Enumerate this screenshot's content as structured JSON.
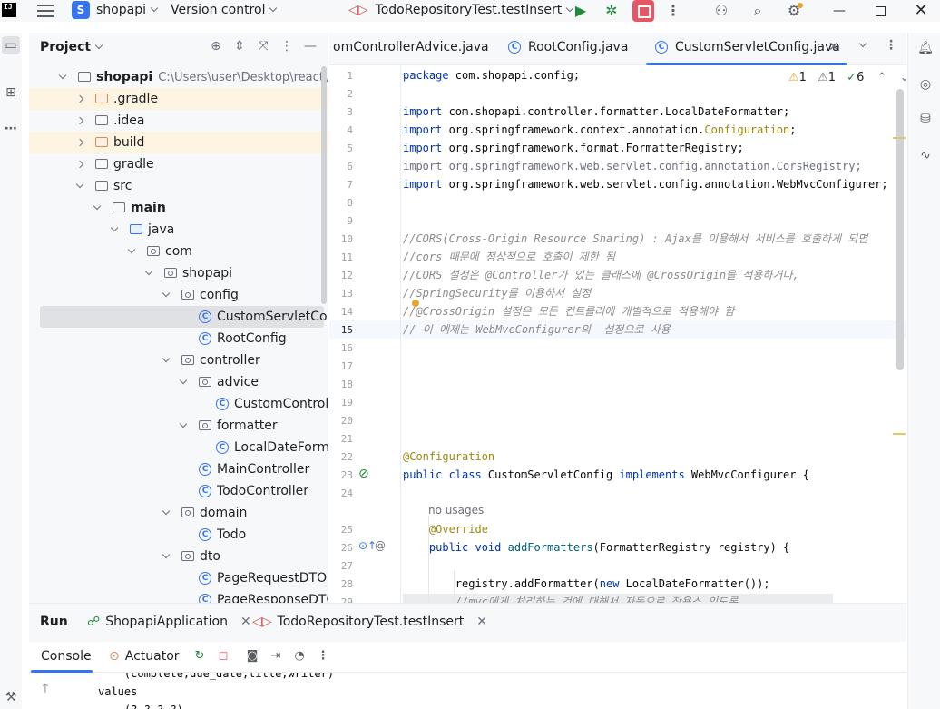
{
  "titlebar": {
    "logo_text": "IJ",
    "project_badge": "S",
    "project_name": "shopapi",
    "vcs_label": "Version control",
    "run_config": "TodoRepositoryTest.testInsert"
  },
  "project_panel": {
    "title": "Project",
    "tree": [
      {
        "label": "shopapi",
        "path": "C:\\Users\\user\\Desktop\\react\\backe",
        "bold": true,
        "level": 0,
        "arrow": "down",
        "icon": "module"
      },
      {
        "label": ".gradle",
        "level": 1,
        "arrow": "right",
        "icon": "folder-orange",
        "highlight": true
      },
      {
        "label": ".idea",
        "level": 1,
        "arrow": "right",
        "icon": "folder"
      },
      {
        "label": "build",
        "level": 1,
        "arrow": "right",
        "icon": "folder-orange",
        "highlight": true
      },
      {
        "label": "gradle",
        "level": 1,
        "arrow": "right",
        "icon": "folder"
      },
      {
        "label": "src",
        "level": 1,
        "arrow": "down",
        "icon": "folder"
      },
      {
        "label": "main",
        "level": 2,
        "arrow": "down",
        "icon": "folder",
        "bold": true
      },
      {
        "label": "java",
        "level": 3,
        "arrow": "down",
        "icon": "folder-blue"
      },
      {
        "label": "com",
        "level": 4,
        "arrow": "down",
        "icon": "package"
      },
      {
        "label": "shopapi",
        "level": 5,
        "arrow": "down",
        "icon": "package"
      },
      {
        "label": "config",
        "level": 6,
        "arrow": "down",
        "icon": "package"
      },
      {
        "label": "CustomServletConfig",
        "level": 7,
        "icon": "class",
        "selected": true
      },
      {
        "label": "RootConfig",
        "level": 7,
        "icon": "class"
      },
      {
        "label": "controller",
        "level": 6,
        "arrow": "down",
        "icon": "package"
      },
      {
        "label": "advice",
        "level": 7,
        "arrow": "down",
        "icon": "package"
      },
      {
        "label": "CustomControllerAd",
        "level": 8,
        "icon": "class"
      },
      {
        "label": "formatter",
        "level": 7,
        "arrow": "down",
        "icon": "package"
      },
      {
        "label": "LocalDateFormatter",
        "level": 8,
        "icon": "class"
      },
      {
        "label": "MainController",
        "level": 7,
        "icon": "class"
      },
      {
        "label": "TodoController",
        "level": 7,
        "icon": "class"
      },
      {
        "label": "domain",
        "level": 6,
        "arrow": "down",
        "icon": "package"
      },
      {
        "label": "Todo",
        "level": 7,
        "icon": "class"
      },
      {
        "label": "dto",
        "level": 6,
        "arrow": "down",
        "icon": "package"
      },
      {
        "label": "PageRequestDTO",
        "level": 7,
        "icon": "class"
      },
      {
        "label": "PageResponseDTO",
        "level": 7,
        "icon": "class"
      }
    ]
  },
  "tabs": [
    {
      "label": "omControllerAdvice.java",
      "active": false
    },
    {
      "label": "RootConfig.java",
      "active": false
    },
    {
      "label": "CustomServletConfig.java",
      "active": true
    }
  ],
  "editor": {
    "hints": {
      "warn_yellow": "1",
      "warn_grey": "1",
      "ok": "6"
    },
    "usages": "no usages",
    "lines": [
      {
        "n": "1",
        "html": "<span class='kw'>package</span> com.shopapi.config;"
      },
      {
        "n": "2",
        "html": ""
      },
      {
        "n": "3",
        "html": "<span class='kw'>import</span> com.shopapi.controller.formatter.LocalDateFormatter;"
      },
      {
        "n": "4",
        "html": "<span class='kw'>import</span> org.springframework.context.annotation.<span class='ann'>Configuration</span>;"
      },
      {
        "n": "5",
        "html": "<span class='kw'>import</span> org.springframework.format.FormatterRegistry;"
      },
      {
        "n": "6",
        "html": "<span class='grey'>import org.springframework.web.servlet.config.annotation.CorsRegistry;</span>"
      },
      {
        "n": "7",
        "html": "<span class='kw'>import</span> org.springframework.web.servlet.config.annotation.WebMvcConfigurer;"
      },
      {
        "n": "8",
        "html": ""
      },
      {
        "n": "9",
        "html": ""
      },
      {
        "n": "10",
        "html": "<span class='cmt'>//CORS(Cross-Origin Resource Sharing) : Ajax를 이용해서 서비스를 호출하게 되면</span>"
      },
      {
        "n": "11",
        "html": "<span class='cmt'>//cors 때문에 정상적으로 호출이 제한 됨</span>"
      },
      {
        "n": "12",
        "html": "<span class='cmt'>//CORS 설정은 @Controller가 있는 클래스에 @CrossOrigin을 적용하거나,</span>"
      },
      {
        "n": "13",
        "html": "<span class='cmt'>//SpringSecurity를 이용하서 설정</span>"
      },
      {
        "n": "14",
        "html": "<span class='cmt'>//@CrossOrigin 설정은 모든 컨트롤러에 개별적으로 적용해야 함</span>"
      },
      {
        "n": "15",
        "html": "<span class='cmt'>// 이 예제는 WebMvcConfigurer의  설정으로 사용</span>"
      },
      {
        "n": "16",
        "html": ""
      },
      {
        "n": "17",
        "html": ""
      },
      {
        "n": "18",
        "html": ""
      },
      {
        "n": "19",
        "html": ""
      },
      {
        "n": "20",
        "html": ""
      },
      {
        "n": "21",
        "html": ""
      },
      {
        "n": "22",
        "html": "<span class='ann'>@Configuration</span>"
      },
      {
        "n": "23",
        "html": "<span class='kw'>public class</span> CustomServletConfig <span class='kw'>implements</span> WebMvcConfigurer {"
      },
      {
        "n": "24",
        "html": ""
      },
      {
        "n": "25",
        "html": "    <span class='ann'>@Override</span>"
      },
      {
        "n": "26",
        "html": "    <span class='kw'>public void</span> <span class='fn'>addFormatters</span>(FormatterRegistry registry) {"
      },
      {
        "n": "27",
        "html": ""
      },
      {
        "n": "28",
        "html": "        registry.addFormatter(<span class='kw'>new</span> LocalDateFormatter());"
      },
      {
        "n": "29",
        "html": "        <span class='cmt'>//mvc에게 처리하는 것에 대해서 자동으로 작용스 있도록</span>"
      }
    ]
  },
  "run_panel": {
    "title": "Run",
    "tabs": [
      "ShopapiApplication",
      "TodoRepositoryTest.testInsert"
    ],
    "console_label": "Console",
    "actuator_label": "Actuator",
    "output": [
      "    (complete,due_date,title,writer)",
      "values",
      "    (?,?,?,?)"
    ]
  }
}
